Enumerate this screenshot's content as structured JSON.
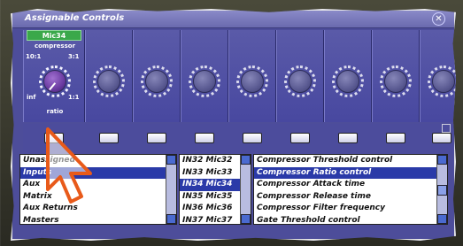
{
  "window": {
    "title": "Assignable Controls",
    "close_label": "✕"
  },
  "strip1": {
    "channel": "Mic34",
    "param": "compressor",
    "range_top_left": "10:1",
    "range_top_right": "3:1",
    "range_bot_left": "inf",
    "range_bot_right": "1:1",
    "footer": "ratio"
  },
  "lists": {
    "categories": [
      "Unassigned",
      "Inputs",
      "Aux",
      "Matrix",
      "Aux Returns",
      "Masters"
    ],
    "channels": [
      "IN32 Mic32",
      "IN33 Mic33",
      "IN34 Mic34",
      "IN35 Mic35",
      "IN36 Mic36",
      "IN37 Mic37"
    ],
    "controls": [
      "Compressor Threshold control",
      "Compressor Ratio control",
      "Compressor Attack time",
      "Compressor Release time",
      "Compressor Filter frequency",
      "Gate Threshold control"
    ]
  },
  "selected": {
    "category": 1,
    "channel": 2,
    "control": 1
  },
  "colors": {
    "window": "#4d4d9a",
    "channel_label": "#3aa84a",
    "selection": "#2a3aa8"
  }
}
